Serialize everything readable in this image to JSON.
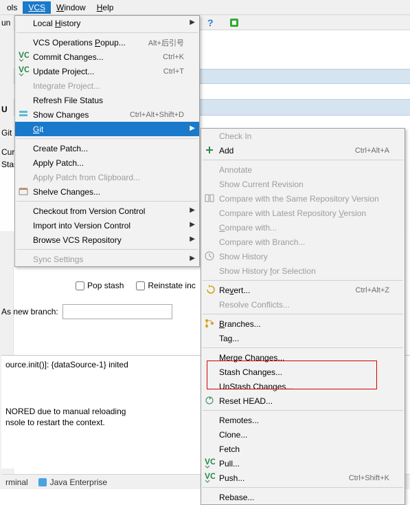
{
  "menubar": {
    "items": [
      {
        "label": "ols",
        "underline_idx": -1
      },
      {
        "label": "VCS",
        "underline_idx": 2
      },
      {
        "label": "Window",
        "underline_idx": 0
      },
      {
        "label": "Help",
        "underline_idx": 0
      }
    ],
    "open_index": 1
  },
  "leftside": {
    "run_label": "un",
    "edge_labels": [
      "U",
      "Git",
      "Cur",
      "Stas"
    ]
  },
  "toolbar_icons": {
    "help": "?",
    "run": "run-icon"
  },
  "checkboxes": {
    "pop_stash": "Pop stash",
    "reinstate": "Reinstate inc"
  },
  "new_branch_label": "As new branch:",
  "console_lines": [
    "ource.init()]: {dataSource-1} inited",
    "",
    "",
    "",
    "NORED due to manual reloading",
    "nsole to restart the context."
  ],
  "statusbar": {
    "items": [
      "rminal",
      "Java Enterprise"
    ]
  },
  "vcs_menu": [
    {
      "label": "Local History",
      "u": 6,
      "submenu": true
    },
    {
      "sep": true
    },
    {
      "label": "VCS Operations Popup...",
      "u": 15,
      "shortcut": "Alt+后引号"
    },
    {
      "label": "Commit Changes...",
      "u": -1,
      "shortcut": "Ctrl+K",
      "icon": "vcs"
    },
    {
      "label": "Update Project...",
      "u": -1,
      "shortcut": "Ctrl+T",
      "icon": "vcs"
    },
    {
      "label": "Integrate Project...",
      "u": -1,
      "disabled": true
    },
    {
      "label": "Refresh File Status",
      "u": -1
    },
    {
      "label": "Show Changes",
      "u": -1,
      "shortcut": "Ctrl+Alt+Shift+D",
      "icon": "changes"
    },
    {
      "label": "Git",
      "u": 0,
      "submenu": true,
      "hover": true
    },
    {
      "sep": true
    },
    {
      "label": "Create Patch...",
      "u": -1
    },
    {
      "label": "Apply Patch...",
      "u": -1
    },
    {
      "label": "Apply Patch from Clipboard...",
      "u": -1,
      "disabled": true
    },
    {
      "label": "Shelve Changes...",
      "u": -1,
      "icon": "shelve"
    },
    {
      "sep": true
    },
    {
      "label": "Checkout from Version Control",
      "u": -1,
      "submenu": true
    },
    {
      "label": "Import into Version Control",
      "u": -1,
      "submenu": true
    },
    {
      "label": "Browse VCS Repository",
      "u": -1,
      "submenu": true
    },
    {
      "sep": true
    },
    {
      "label": "Sync Settings",
      "u": -1,
      "submenu": true,
      "disabled": true
    }
  ],
  "git_menu": [
    {
      "label": "Check In",
      "disabled": true
    },
    {
      "label": "Add",
      "shortcut": "Ctrl+Alt+A",
      "icon": "add"
    },
    {
      "sep": true
    },
    {
      "label": "Annotate",
      "disabled": true
    },
    {
      "label": "Show Current Revision",
      "disabled": true
    },
    {
      "label": "Compare with the Same Repository Version",
      "disabled": true,
      "icon": "cmp"
    },
    {
      "label": "Compare with Latest Repository Version",
      "u": 31,
      "disabled": true
    },
    {
      "label": "Compare with...",
      "u": 0,
      "disabled": true
    },
    {
      "label": "Compare with Branch...",
      "disabled": true
    },
    {
      "label": "Show History",
      "disabled": true,
      "icon": "hist"
    },
    {
      "label": "Show History for Selection",
      "u": 13,
      "disabled": true
    },
    {
      "sep": true
    },
    {
      "label": "Revert...",
      "u": 2,
      "shortcut": "Ctrl+Alt+Z",
      "icon": "revert"
    },
    {
      "label": "Resolve Conflicts...",
      "disabled": true
    },
    {
      "sep": true
    },
    {
      "label": "Branches...",
      "u": 0,
      "icon": "branch"
    },
    {
      "label": "Tag..."
    },
    {
      "sep": true
    },
    {
      "label": "Merge Changes..."
    },
    {
      "label": "Stash Changes..."
    },
    {
      "label": "UnStash Changes..."
    },
    {
      "label": "Reset HEAD...",
      "icon": "reset"
    },
    {
      "sep": true
    },
    {
      "label": "Remotes..."
    },
    {
      "label": "Clone..."
    },
    {
      "label": "Fetch"
    },
    {
      "label": "Pull...",
      "icon": "vcs"
    },
    {
      "label": "Push...",
      "shortcut": "Ctrl+Shift+K",
      "icon": "vcs"
    },
    {
      "sep": true
    },
    {
      "label": "Rebase..."
    }
  ]
}
